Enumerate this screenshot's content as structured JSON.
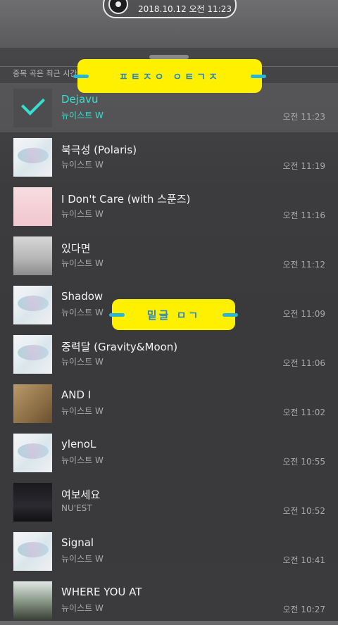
{
  "status": {
    "date_time": "2018.10.12 오전 11:23",
    "icon": "disc-icon"
  },
  "header": {
    "subtitle": "중복 곡은 최근 시간"
  },
  "stickers": {
    "top_label": "ㅍㅌㅈㅇ ㅇㅌㄱㅈ",
    "middle_label": "밑글 ㅁㄱ",
    "color": "#fff000",
    "band_color": "#29b6d6"
  },
  "accent_color": "#35e0d0",
  "songs": [
    {
      "title": "Dejavu",
      "artist": "뉴이스트 W",
      "time": "오전 11:23",
      "active": true
    },
    {
      "title": "북극성 (Polaris)",
      "artist": "뉴이스트 W",
      "time": "오전 11:19"
    },
    {
      "title": "I Don't Care (with 스푼즈)",
      "artist": "뉴이스트 W",
      "time": "오전 11:16"
    },
    {
      "title": "있다면",
      "artist": "뉴이스트 W",
      "time": "오전 11:12"
    },
    {
      "title": "Shadow",
      "artist": "뉴이스트 W",
      "time": "오전 11:09"
    },
    {
      "title": "중력달 (Gravity&Moon)",
      "artist": "뉴이스트 W",
      "time": "오전 11:06"
    },
    {
      "title": "AND I",
      "artist": "뉴이스트 W",
      "time": "오전 11:02"
    },
    {
      "title": "ylenoL",
      "artist": "뉴이스트 W",
      "time": "오전 10:55"
    },
    {
      "title": "여보세요",
      "artist": "NU'EST",
      "time": "오전 10:52"
    },
    {
      "title": "Signal",
      "artist": "뉴이스트 W",
      "time": "오전 10:41"
    },
    {
      "title": "WHERE YOU AT",
      "artist": "뉴이스트 W",
      "time": "오전 10:27"
    }
  ]
}
